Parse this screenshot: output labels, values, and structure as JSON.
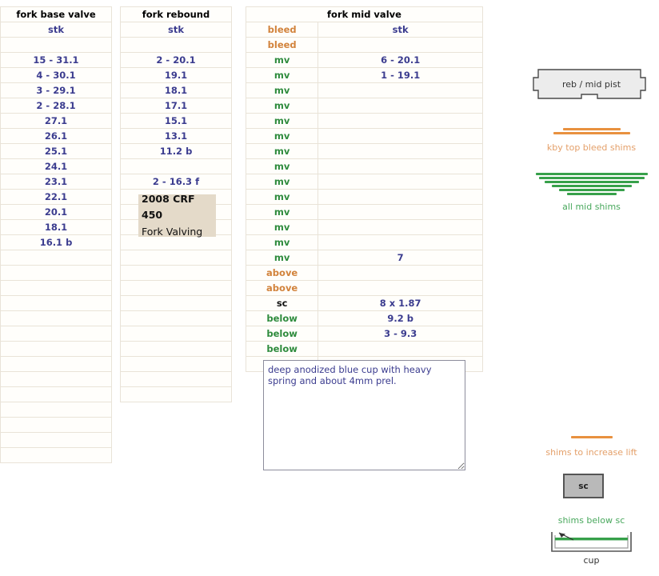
{
  "base_valve": {
    "header": "fork base valve",
    "subheader": "stk",
    "rows": [
      "",
      "15 - 31.1",
      "4 - 30.1",
      "3 - 29.1",
      "2 - 28.1",
      "27.1",
      "26.1",
      "25.1",
      "24.1",
      "23.1",
      "22.1",
      "20.1",
      "18.1",
      "16.1 b",
      "",
      "",
      "",
      "",
      "",
      "",
      "",
      "",
      "",
      "",
      "",
      "",
      "",
      ""
    ]
  },
  "rebound": {
    "header": "fork rebound",
    "subheader": "stk",
    "rows": [
      "",
      "2 - 20.1",
      "19.1",
      "18.1",
      "17.1",
      "15.1",
      "13.1",
      "11.2 b",
      "",
      "2 - 16.3 f",
      "",
      "",
      "",
      "",
      "",
      "",
      "",
      "",
      "",
      "",
      "",
      "",
      "",
      ""
    ]
  },
  "mid_valve": {
    "header": "fork mid valve",
    "subheader_label": "",
    "subheader_value": "stk",
    "rows": [
      {
        "label": "bleed",
        "kind": "bleed",
        "value": "stk",
        "value_kind": "stk"
      },
      {
        "label": "bleed",
        "kind": "bleed",
        "value": ""
      },
      {
        "label": "mv",
        "kind": "mv",
        "value": "6 - 20.1"
      },
      {
        "label": "mv",
        "kind": "mv",
        "value": "1 - 19.1"
      },
      {
        "label": "mv",
        "kind": "mv",
        "value": ""
      },
      {
        "label": "mv",
        "kind": "mv",
        "value": ""
      },
      {
        "label": "mv",
        "kind": "mv",
        "value": ""
      },
      {
        "label": "mv",
        "kind": "mv",
        "value": ""
      },
      {
        "label": "mv",
        "kind": "mv",
        "value": ""
      },
      {
        "label": "mv",
        "kind": "mv",
        "value": ""
      },
      {
        "label": "mv",
        "kind": "mv",
        "value": ""
      },
      {
        "label": "mv",
        "kind": "mv",
        "value": ""
      },
      {
        "label": "mv",
        "kind": "mv",
        "value": ""
      },
      {
        "label": "mv",
        "kind": "mv",
        "value": ""
      },
      {
        "label": "mv",
        "kind": "mv",
        "value": ""
      },
      {
        "label": "mv",
        "kind": "mv",
        "value": "7"
      },
      {
        "label": "above",
        "kind": "above",
        "value": ""
      },
      {
        "label": "above",
        "kind": "above",
        "value": ""
      },
      {
        "label": "sc",
        "kind": "sc",
        "value": "8 x 1.87"
      },
      {
        "label": "below",
        "kind": "below",
        "value": "9.2 b"
      },
      {
        "label": "below",
        "kind": "below",
        "value": "3 - 9.3"
      },
      {
        "label": "below",
        "kind": "below",
        "value": ""
      },
      {
        "label": "below",
        "kind": "below",
        "value": ""
      }
    ]
  },
  "title_card": {
    "line1": "2008 CRF 450",
    "line2": "Fork Valving"
  },
  "notes": {
    "value": "deep anodized blue cup with heavy spring and about 4mm prel.",
    "placeholder": ""
  },
  "legend": {
    "piston_label": "reb / mid pist",
    "orange_stack_caption": "kby top bleed shims",
    "green_stack_caption": "all mid shims",
    "lift_caption": "shims to increase lift",
    "sc_label": "sc",
    "below_sc_caption": "shims below sc",
    "cup_caption": "cup",
    "orange_shims": [
      72,
      96
    ],
    "green_shims": [
      140,
      132,
      118,
      100,
      82,
      62
    ],
    "lift_shims": [
      52
    ]
  },
  "colors": {
    "value_navy": "#3b3c8f",
    "orange": "#e8913f",
    "orange_text": "#d2833c",
    "green": "#37a04a",
    "green_text": "#2e8b3d",
    "title_bg": "#e4dac9"
  }
}
